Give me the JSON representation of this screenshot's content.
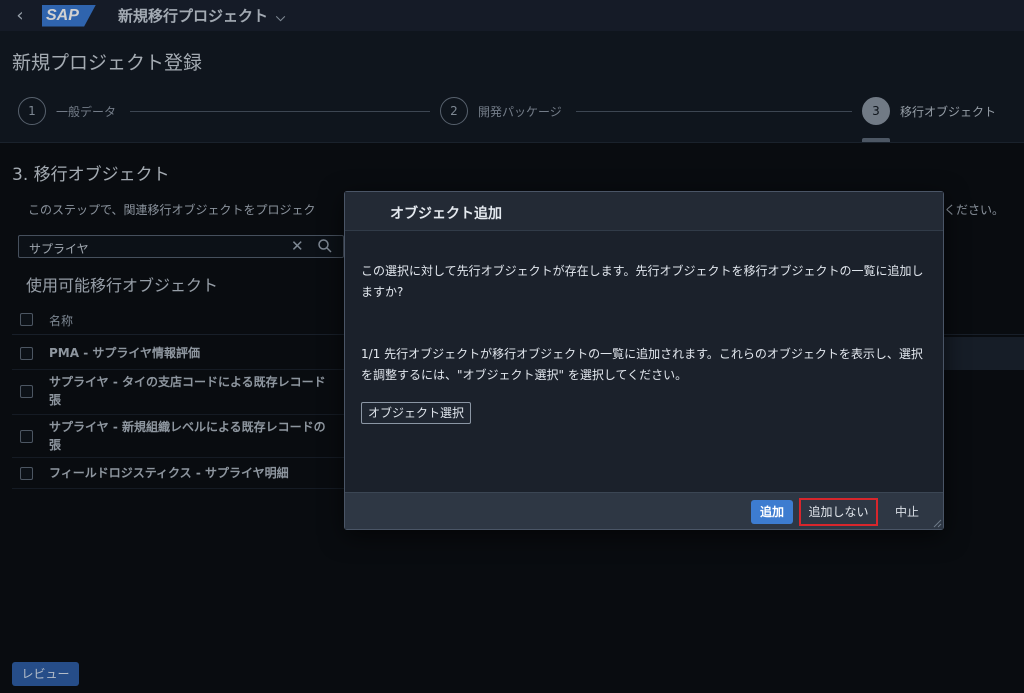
{
  "shellbar": {
    "back_icon": "chevron-left-icon",
    "logo": "SAP",
    "app_title": "新規移行プロジェクト",
    "app_title_icon": "chevron-down-icon"
  },
  "header": {
    "page_title": "新規プロジェクト登録",
    "steps": [
      {
        "number": "1",
        "label": "一般データ"
      },
      {
        "number": "2",
        "label": "開発パッケージ"
      },
      {
        "number": "3",
        "label": "移行オブジェクト"
      }
    ]
  },
  "section": {
    "title": "3. 移行オブジェクト",
    "description": "このステップで、関連移行オブジェクトをプロジェク",
    "description_tail": "ください。"
  },
  "search": {
    "value": "サプライヤ",
    "clear_icon": "close-icon",
    "search_icon": "search-icon"
  },
  "list": {
    "title": "使用可能移行オブジェクト",
    "column_header": "名称",
    "rows": [
      "PMA - サプライヤ情報評価",
      "サプライヤ - タイの支店コードによる既存レコード\n張",
      "サプライヤ - 新規組織レベルによる既存レコードの\n張",
      "フィールドロジスティクス - サプライヤ明細"
    ]
  },
  "footer": {
    "review_label": "レビュー"
  },
  "dialog": {
    "title": "オブジェクト追加",
    "text1": "この選択に対して先行オブジェクトが存在します。先行オブジェクトを移行オブジェクトの一覧に追加しますか?",
    "text2": "1/1 先行オブジェクトが移行オブジェクトの一覧に追加されます。これらのオブジェクトを表示し、選択を調整するには、\"オブジェクト選択\" を選択してください。",
    "select_button": "オブジェクト選択",
    "buttons": {
      "add": "追加",
      "no_add": "追加しない",
      "cancel": "中止"
    },
    "colors": {
      "emphasized": "#3d7cd0",
      "highlight": "#d8262c"
    }
  }
}
